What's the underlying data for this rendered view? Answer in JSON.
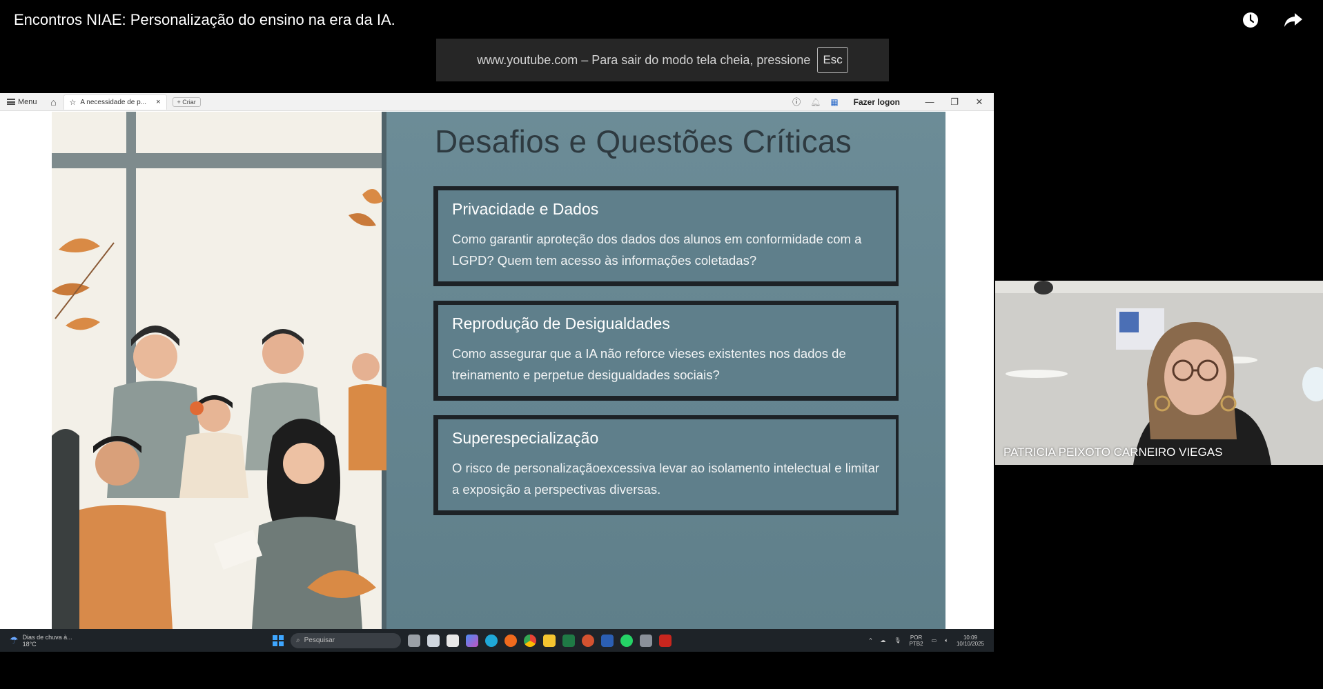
{
  "video": {
    "title": "Encontros NIAE: Personalização do ensino na era da IA.",
    "icons": [
      "watch-later-icon",
      "share-icon"
    ]
  },
  "fullscreen_toast": {
    "message": "www.youtube.com – Para sair do modo tela cheia, pressione",
    "key": "Esc"
  },
  "browser": {
    "menu_label": "Menu",
    "tab_label": "A necessidade de p...",
    "new_tab_label": "+ Criar",
    "logon_label": "Fazer logon"
  },
  "slide": {
    "title": "Desafios e Questões Críticas",
    "cards": [
      {
        "title": "Privacidade e Dados",
        "text": "Como garantir aproteção dos dados dos alunos em conformidade com a LGPD? Quem tem acesso às informações coletadas?"
      },
      {
        "title": "Reprodução de Desigualdades",
        "text": "Como assegurar que a IA não reforce vieses existentes nos dados de treinamento e perpetue desigualdades sociais?"
      },
      {
        "title": "Superespecialização",
        "text": "O risco de personalizaçãoexcessiva levar ao isolamento intelectual e limitar a exposição a perspectivas diversas."
      }
    ]
  },
  "taskbar": {
    "weather_line1": "Dias de chuva à...",
    "weather_line2": "18°C",
    "search_placeholder": "Pesquisar",
    "lang_line1": "POR",
    "lang_line2": "PTB2",
    "time": "10:09",
    "date": "10/10/2025"
  },
  "participant": {
    "name": "PATRICIA PEIXOTO CARNEIRO VIEGAS"
  },
  "colors": {
    "slide_bg": "#6d8e98",
    "card_border": "#1d2226",
    "title_text": "#2e3a40",
    "illustration_orange": "#d98a45"
  }
}
